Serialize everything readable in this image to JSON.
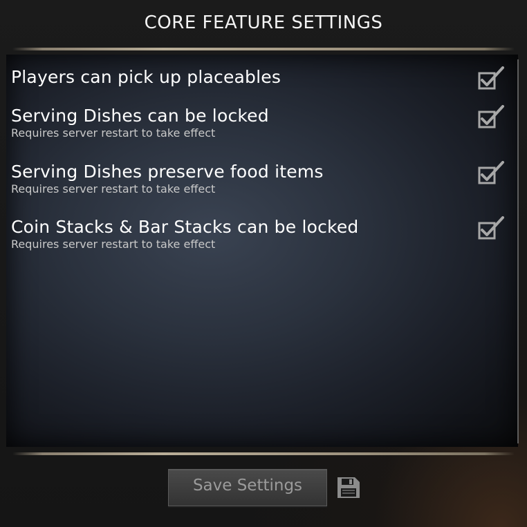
{
  "window": {
    "title": "CORE FEATURE SETTINGS"
  },
  "settings": [
    {
      "label": "Players can pick up placeables",
      "note": "",
      "checked": true
    },
    {
      "label": "Serving Dishes can be locked",
      "note": "Requires server restart to take effect",
      "checked": true
    },
    {
      "label": "Serving Dishes preserve food items",
      "note": "Requires server restart to take effect",
      "checked": true
    },
    {
      "label": "Coin Stacks & Bar Stacks can be locked",
      "note": "Requires server restart to take effect",
      "checked": true
    }
  ],
  "footer": {
    "save_label": "Save Settings",
    "save_icon": "floppy-disk-icon"
  },
  "icons": {
    "checkbox": "checkbox-checked-icon"
  },
  "colors": {
    "text": "#ffffff",
    "note_text": "#c9c9c9",
    "button_text": "#9b9b9b",
    "checkbox": "#a8a8a8"
  }
}
